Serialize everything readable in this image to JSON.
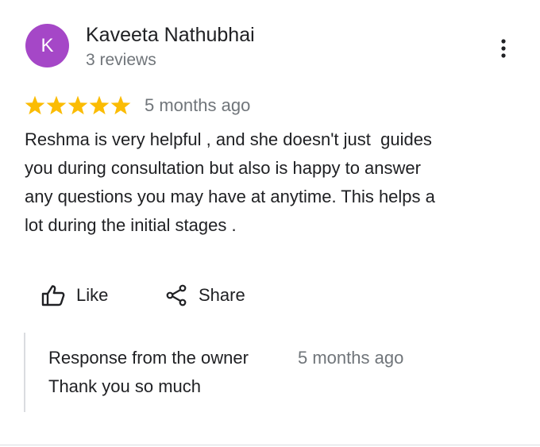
{
  "reviewer": {
    "initial": "K",
    "name": "Kaveeta Nathubhai",
    "review_count": "3 reviews",
    "avatar_color": "#a547c7"
  },
  "menu": {
    "icon": "more-vert-icon"
  },
  "review": {
    "rating": 5,
    "max_rating": 5,
    "star_color": "#fbbc04",
    "date": "5 months ago",
    "text": "Reshma is very helpful , and she doesn't just  guides\nyou during consultation but also is happy to answer\nany questions you may have at anytime. This helps a\nlot during the initial stages ."
  },
  "actions": {
    "like_label": "Like",
    "like_icon": "thumb-up-icon",
    "share_label": "Share",
    "share_icon": "share-icon"
  },
  "owner_response": {
    "title": "Response from the owner",
    "date": "5 months ago",
    "text": "Thank you so much"
  }
}
